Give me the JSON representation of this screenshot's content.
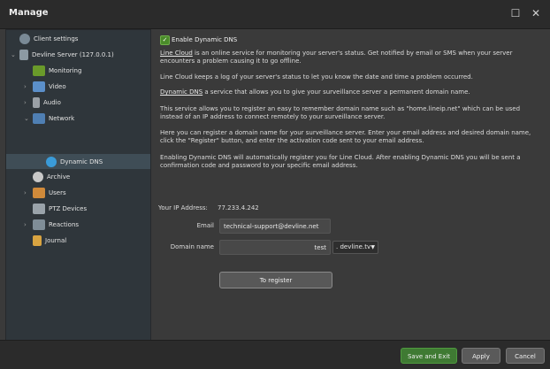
{
  "window": {
    "title": "Manage"
  },
  "sidebar": {
    "items": [
      {
        "label": "Client settings",
        "icon": "gear-icon"
      },
      {
        "label": "Devline Server (127.0.0.1)",
        "icon": "server-icon"
      },
      {
        "label": "Monitoring",
        "icon": "monitoring-icon"
      },
      {
        "label": "Video",
        "icon": "video-icon"
      },
      {
        "label": "Audio",
        "icon": "microphone-icon"
      },
      {
        "label": "Network",
        "icon": "network-icon"
      },
      {
        "label": "Dynamic DNS",
        "icon": "globe-icon"
      },
      {
        "label": "Archive",
        "icon": "archive-icon"
      },
      {
        "label": "Users",
        "icon": "users-icon"
      },
      {
        "label": "PTZ Devices",
        "icon": "ptz-icon"
      },
      {
        "label": "Reactions",
        "icon": "reactions-icon"
      },
      {
        "label": "Journal",
        "icon": "journal-icon"
      }
    ],
    "selected": "Dynamic DNS"
  },
  "main": {
    "enable_label": "Enable Dynamic DNS",
    "enable_checked": true,
    "p1_link": "Line Cloud",
    "p1_text": " is an online service for monitoring your server's status. Get notified by email or SMS when your server encounters a problem causing it to go offline.",
    "p2": "Line Cloud keeps a log of your server's status to let you know the date and time a problem occurred.",
    "p3_link": "Dynamic DNS",
    "p3_text": " a service that allows you to give your surveillance server a permanent domain name.",
    "p4": "This service allows you to register an easy to remember domain name such as \"home.lineip.net\" which can be used instead of an IP address to connect remotely to your surveillance server.",
    "p5": "Here you can register a domain name for your surveillance server. Enter your email address and desired domain name, click the \"Register\" button, and enter the activation code sent to your email address.",
    "p6": "Enabling Dynamic DNS will automatically register you for Line Cloud. After enabling Dynamic DNS you will be sent a confirmation code and password to your specific email address.",
    "ip_label": "Your IP Address:",
    "ip_value": "77.233.4.242",
    "email_label": "Email",
    "email_value": "technical-support@devline.net",
    "domain_label": "Domain name",
    "domain_value": "test",
    "domain_suffix": ". devline.tv",
    "register_label": "To register"
  },
  "footer": {
    "save_label": "Save and Exit",
    "apply_label": "Apply",
    "cancel_label": "Cancel"
  },
  "colors": {
    "accent_green": "#3f7a33",
    "selected_row": "#3f4d56"
  }
}
